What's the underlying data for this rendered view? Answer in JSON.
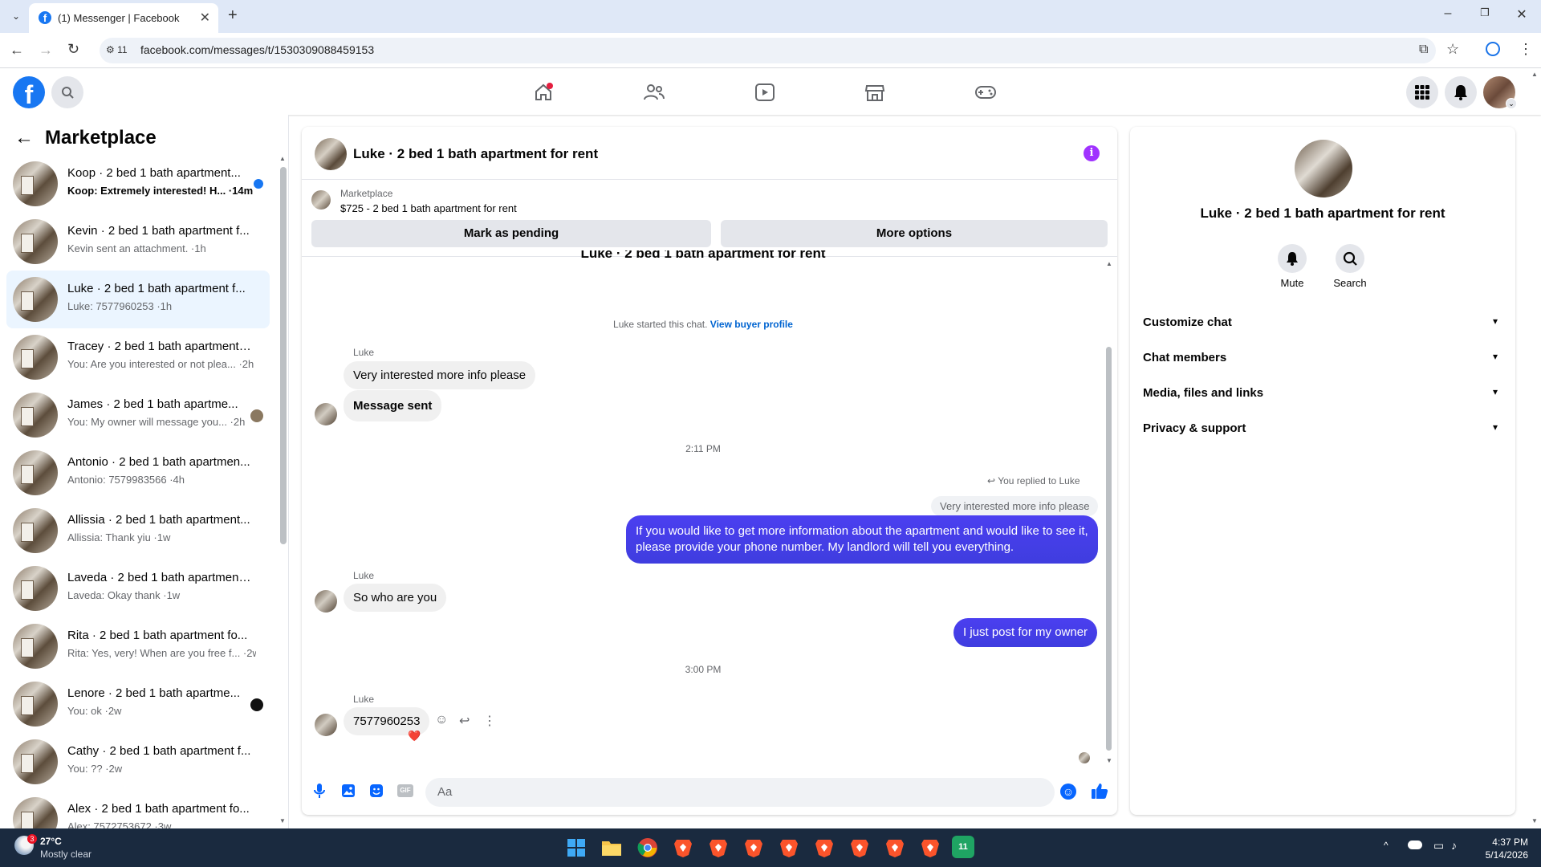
{
  "browser": {
    "tab_title": "(1) Messenger | Facebook",
    "url": "facebook.com/messages/t/1530309088459153",
    "site_info_count": "11"
  },
  "sidebar": {
    "title": "Marketplace",
    "conversations": [
      {
        "name": "Koop · 2 bed 1 bath apartment...",
        "snippet": "Koop: Extremely interested! H... ·14m",
        "unread": true
      },
      {
        "name": "Kevin · 2 bed 1 bath apartment f...",
        "snippet": "Kevin sent an attachment. ·1h"
      },
      {
        "name": "Luke · 2 bed 1 bath apartment f...",
        "snippet": "Luke: 7577960253 ·1h",
        "active": true
      },
      {
        "name": "Tracey · 2 bed 1 bath apartment ...",
        "snippet": "You: Are you interested or not plea... ·2h"
      },
      {
        "name": "James · 2 bed 1 bath apartme...",
        "snippet": "You: My owner will message you... ·2h"
      },
      {
        "name": "Antonio · 2 bed 1 bath apartmen...",
        "snippet": "Antonio: 7579983566 ·4h"
      },
      {
        "name": "Allissia · 2 bed 1 bath apartment...",
        "snippet": "Allissia: Thank yiu ·1w"
      },
      {
        "name": "Laveda · 2 bed 1 bath apartment...",
        "snippet": "Laveda: Okay thank ·1w"
      },
      {
        "name": "Rita · 2 bed 1 bath apartment fo...",
        "snippet": "Rita: Yes, very! When are you free f... ·2w"
      },
      {
        "name": "Lenore · 2 bed 1 bath apartme...",
        "snippet": "You: ok ·2w"
      },
      {
        "name": "Cathy · 2 bed 1 bath apartment f...",
        "snippet": "You: ?? ·2w"
      },
      {
        "name": "Alex · 2 bed 1 bath apartment fo...",
        "snippet": "Alex: 7572753672 ·3w"
      }
    ]
  },
  "chat": {
    "title": "Luke · 2 bed 1 bath apartment for rent",
    "listing_source": "Marketplace",
    "listing_title": "$725 - 2 bed 1 bath apartment for rent",
    "mark_pending_label": "Mark as pending",
    "more_options_label": "More options",
    "partial_header": "Luke · 2 bed 1 bath apartment for rent",
    "started_text": "Luke started this chat.",
    "view_profile_link": "View buyer profile",
    "sender_name": "Luke",
    "msg1": "Very interested more info please",
    "msg2": "Message sent",
    "time1": "2:11 PM",
    "replied_label": "You replied to Luke",
    "quoted": "Very interested more info please",
    "out1": "If you would like to get more information about the apartment and would like to see it, please provide your phone number. My landlord will tell you everything.",
    "msg3": "So who are you",
    "out2": "I just post for my owner",
    "time2": "3:00 PM",
    "msg4": "7577960253",
    "reaction": "❤️",
    "input_placeholder": "Aa"
  },
  "details": {
    "title": "Luke · 2 bed 1 bath apartment for rent",
    "mute_label": "Mute",
    "search_label": "Search",
    "sections": [
      "Customize chat",
      "Chat members",
      "Media, files and links",
      "Privacy & support"
    ]
  },
  "taskbar": {
    "weather_temp": "27°C",
    "weather_desc": "Mostly clear",
    "weather_badge": "3",
    "time": "4:37 PM",
    "date": "5/14/2026",
    "app_badge": "11"
  },
  "colors": {
    "fb_blue": "#1877f2",
    "outgoing_bubble": "#4b3ff0",
    "active_conv": "#ebf5ff",
    "info_purple": "#a033ff"
  }
}
